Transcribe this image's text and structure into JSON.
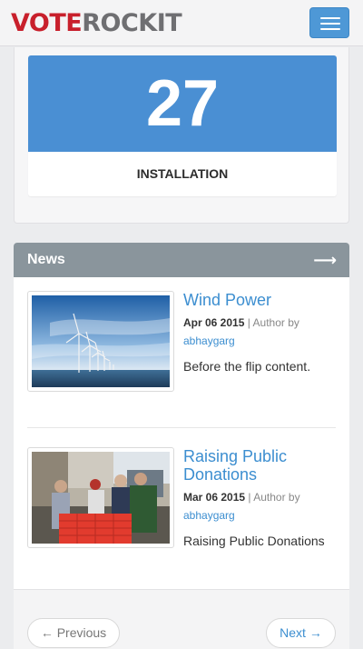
{
  "brand": {
    "part1": "VOTE",
    "part2": "ROCKIT"
  },
  "header": {
    "menu_icon": "hamburger-icon"
  },
  "stat": {
    "value": "27",
    "label": "INSTALLATION"
  },
  "news": {
    "title": "News",
    "arrow": "⟶",
    "items": [
      {
        "title": "Wind Power",
        "date": "Apr 06 2015",
        "separator": "|",
        "author_prefix": "Author by",
        "author": "abhaygarg",
        "excerpt": "Before the flip content."
      },
      {
        "title": "Raising Public Donations",
        "date": "Mar 06 2015",
        "separator": "|",
        "author_prefix": "Author by",
        "author": "abhaygarg",
        "excerpt": "Raising Public Donations"
      }
    ]
  },
  "pager": {
    "prev": "← Previous",
    "next": "Next →"
  },
  "colors": {
    "accent": "#4a8fd3",
    "brand_red": "#c8202c",
    "news_header": "#8a959c",
    "link": "#3c8ed0"
  }
}
